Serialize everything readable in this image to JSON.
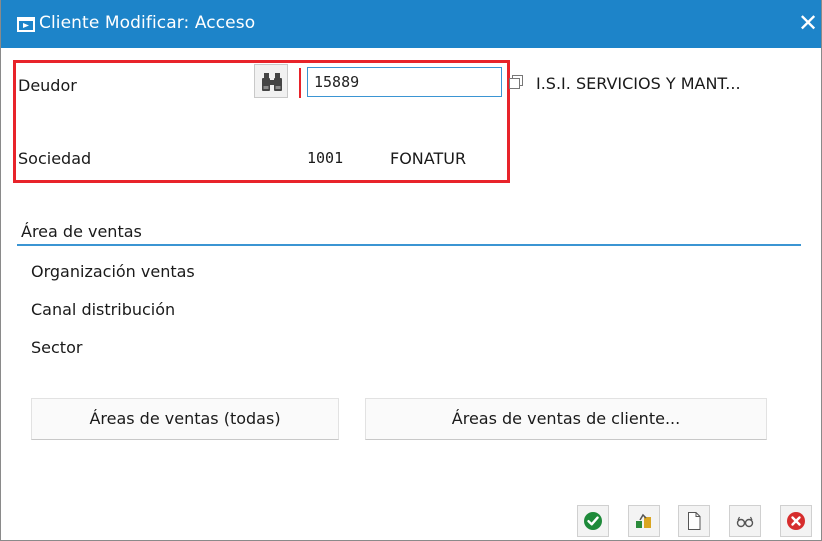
{
  "window": {
    "title": "Cliente Modificar: Acceso",
    "close_glyph": "✕"
  },
  "form": {
    "deudor_label": "Deudor",
    "deudor_value": "15889",
    "deudor_name": "I.S.I. SERVICIOS Y MANT...",
    "sociedad_label": "Sociedad",
    "sociedad_code": "1001",
    "sociedad_name": "FONATUR"
  },
  "sales_area": {
    "title": "Área de ventas",
    "fields": [
      "Organización ventas",
      "Canal distribución",
      "Sector"
    ]
  },
  "buttons": {
    "all_areas": "Áreas de ventas (todas)",
    "client_areas": "Áreas de ventas de cliente..."
  },
  "toolbar": {
    "icons": [
      "check-icon",
      "fetch-icon",
      "new-document-icon",
      "glasses-icon",
      "cancel-icon"
    ]
  },
  "colors": {
    "titlebar": "#1d84c9",
    "highlight": "#e8232a",
    "accent": "#3b95d3",
    "ok": "#1e8a3a",
    "cancel": "#d62d2d"
  }
}
